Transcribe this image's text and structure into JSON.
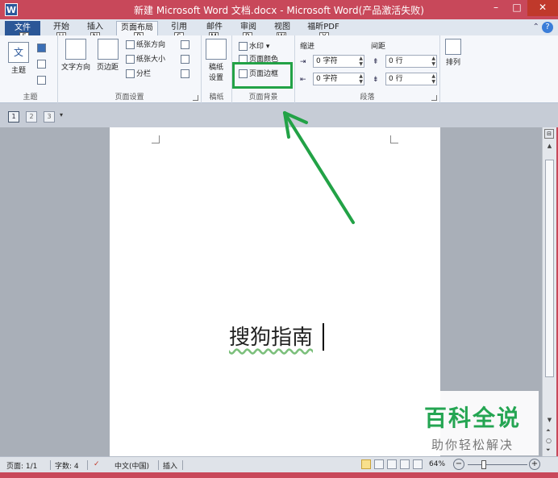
{
  "window": {
    "title": "新建 Microsoft Word 文档.docx - Microsoft Word(产品激活失败)",
    "app_icon": "W",
    "controls": {
      "minimize": "–",
      "maximize": "□",
      "close": "✕"
    }
  },
  "tabs": {
    "file": "文件",
    "items": [
      {
        "label": "开始",
        "keytip": "H"
      },
      {
        "label": "插入",
        "keytip": "N"
      },
      {
        "label": "页面布局",
        "keytip": "P"
      },
      {
        "label": "引用",
        "keytip": "S"
      },
      {
        "label": "邮件",
        "keytip": "M"
      },
      {
        "label": "审阅",
        "keytip": "R"
      },
      {
        "label": "视图",
        "keytip": "W"
      },
      {
        "label": "福昕PDF",
        "keytip": "Y"
      }
    ],
    "file_keytip": "F",
    "help": "?"
  },
  "ribbon": {
    "themes": {
      "label": "主题",
      "theme_button": "主题",
      "theme_icon_letter": "文"
    },
    "page_setup": {
      "label": "页面设置",
      "text_direction": "文字方向",
      "margins": "页边距",
      "orientation": "纸张方向",
      "size": "纸张大小",
      "columns": "分栏"
    },
    "paper": {
      "label": "稿纸",
      "paper_settings_line1": "稿纸",
      "paper_settings_line2": "设置"
    },
    "page_background": {
      "label": "页面背景",
      "watermark": "水印",
      "page_color": "页面颜色",
      "page_borders": "页面边框"
    },
    "paragraph": {
      "label": "段落",
      "indent": "缩进",
      "spacing": "间距",
      "indent_left": "0 字符",
      "indent_right": "0 字符",
      "spacing_before": "0 行",
      "spacing_after": "0 行"
    },
    "arrange": {
      "label": "排列"
    }
  },
  "quickbar": {
    "page1": "1",
    "page2": "2",
    "page3": "3"
  },
  "document": {
    "text": "搜狗指南"
  },
  "watermark_overlay": {
    "title": "百科全说",
    "subtitle": "助你轻松解决"
  },
  "statusbar": {
    "page": "页面: 1/1",
    "words": "字数: 4",
    "language": "中文(中国)",
    "mode": "插入",
    "zoom": "64%"
  },
  "colors": {
    "highlight": "#22a246",
    "title_bar": "#c8485a",
    "file_tab": "#2b5797"
  }
}
